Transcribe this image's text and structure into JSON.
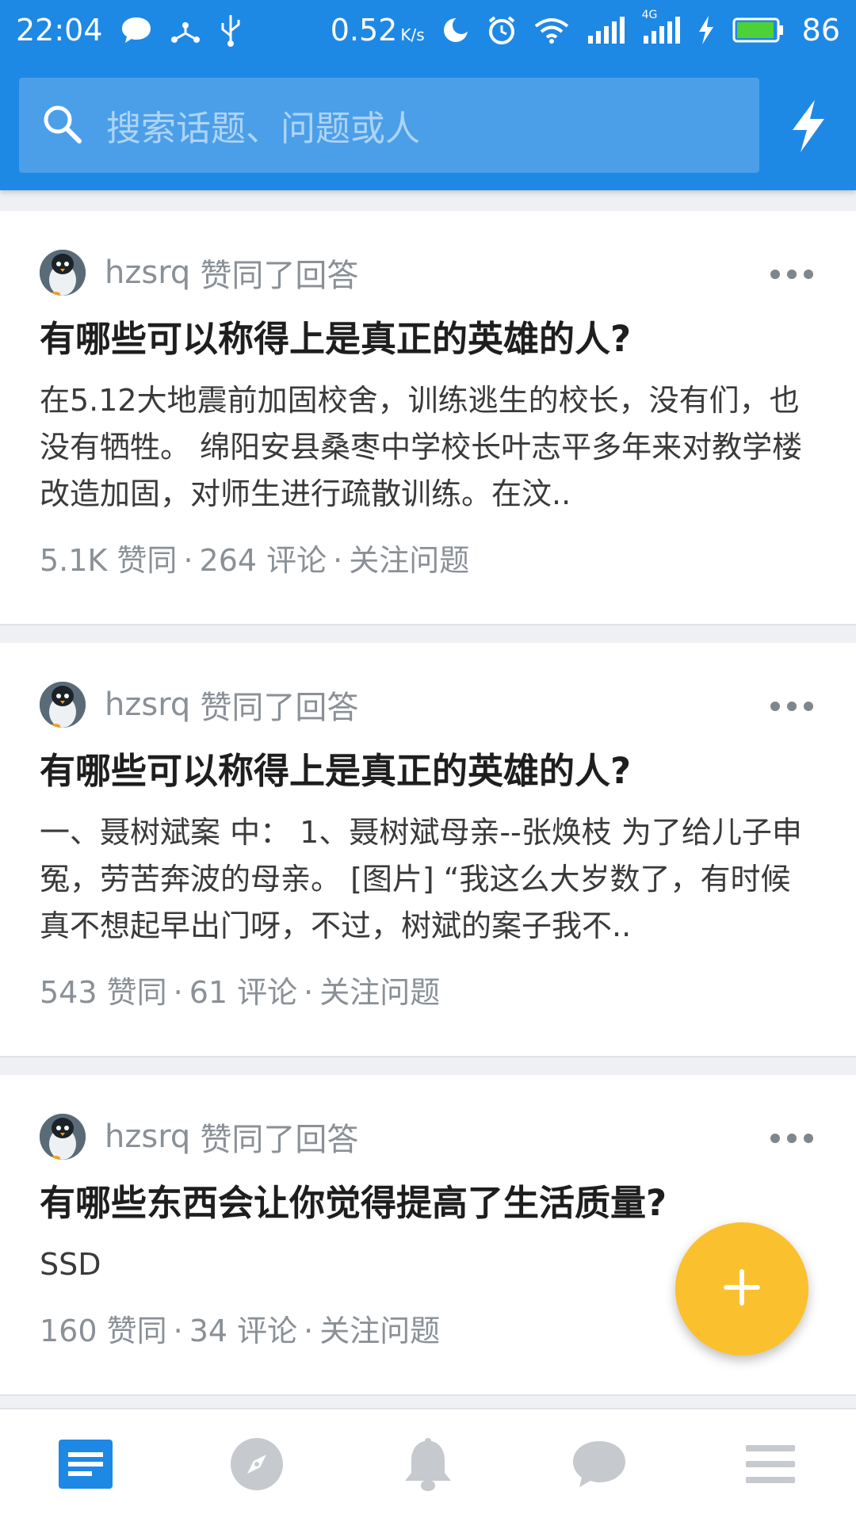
{
  "status_bar": {
    "time": "22:04",
    "net_speed": "0.52",
    "net_unit": "K/s",
    "net_type": "4G",
    "battery": "86"
  },
  "search": {
    "placeholder": "搜索话题、问题或人",
    "icon": "search-icon",
    "action_icon": "lightning-icon"
  },
  "feed": [
    {
      "user": "hzsrq",
      "action": "赞同了回答",
      "title": "有哪些可以称得上是真正的英雄的人?",
      "excerpt": "在5.12大地震前加固校舍，训练逃生的校长，没有们，也没有牺牲。 绵阳安县桑枣中学校长叶志平多年来对教学楼改造加固，对师生进行疏散训练。在汶..",
      "likes": "5.1K 赞同",
      "comments": "264 评论",
      "follow": "关注问题"
    },
    {
      "user": "hzsrq",
      "action": "赞同了回答",
      "title": "有哪些可以称得上是真正的英雄的人?",
      "excerpt": "一、聂树斌案 中： 1、聂树斌母亲--张焕枝 为了给儿子申冤，劳苦奔波的母亲。 [图片] “我这么大岁数了，有时候真不想起早出门呀，不过，树斌的案子我不..",
      "likes": "543 赞同",
      "comments": "61 评论",
      "follow": "关注问题"
    },
    {
      "user": "hzsrq",
      "action": "赞同了回答",
      "title": "有哪些东西会让你觉得提高了生活质量?",
      "excerpt": "SSD",
      "likes": "160 赞同",
      "comments": "34 评论",
      "follow": "关注问题"
    }
  ],
  "separator": "·",
  "fab": {
    "icon": "plus-icon"
  },
  "bottom_nav": [
    {
      "icon": "feed-icon",
      "active": true
    },
    {
      "icon": "compass-icon",
      "active": false
    },
    {
      "icon": "bell-icon",
      "active": false
    },
    {
      "icon": "chat-icon",
      "active": false
    },
    {
      "icon": "menu-icon",
      "active": false
    }
  ],
  "colors": {
    "header": "#1e88e5",
    "accent": "#fbc02d",
    "active_tab": "#1e88e5",
    "inactive_tab": "#c6c9cd"
  }
}
